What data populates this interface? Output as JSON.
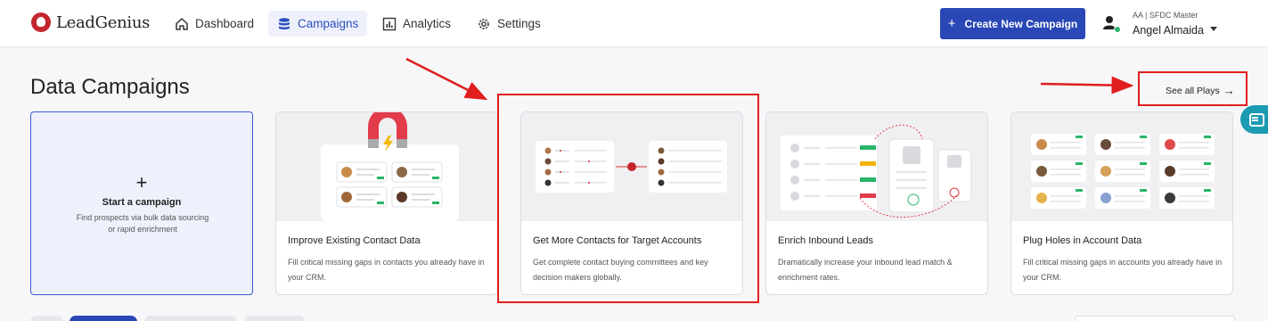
{
  "brand": {
    "name": "LeadGenius"
  },
  "nav": {
    "items": [
      {
        "label": "Dashboard",
        "icon": "home-icon"
      },
      {
        "label": "Campaigns",
        "icon": "database-icon",
        "active": true
      },
      {
        "label": "Analytics",
        "icon": "bar-chart-icon"
      },
      {
        "label": "Settings",
        "icon": "gear-icon"
      }
    ]
  },
  "header": {
    "create_button": "Create New Campaign",
    "create_icon": "+",
    "user_org": "AA | SFDC Master",
    "user_name": "Angel Almaida"
  },
  "main": {
    "title": "Data Campaigns",
    "see_all": "See all Plays",
    "see_all_arrow": "→",
    "start_card": {
      "plus": "+",
      "title": "Start a campaign",
      "description": "Find prospects via bulk data sourcing or rapid enrichment"
    },
    "cards": [
      {
        "title": "Improve Existing Contact Data",
        "description": "Fill critical missing gaps in contacts you already have in your CRM."
      },
      {
        "title": "Get More Contacts for Target Accounts",
        "description": "Get complete contact buying committees and key decision makers globally."
      },
      {
        "title": "Enrich Inbound Leads",
        "description": "Dramatically increase your inbound lead match & enrichment rates."
      },
      {
        "title": "Plug Holes in Account Data",
        "description": "Fill critical missing gaps in accounts you already have in your CRM."
      }
    ]
  },
  "colors": {
    "accent": "#2a47b6",
    "annotation": "#e01e1e",
    "status_green": "#29b56b",
    "chat_tab": "#1b9bb1"
  }
}
